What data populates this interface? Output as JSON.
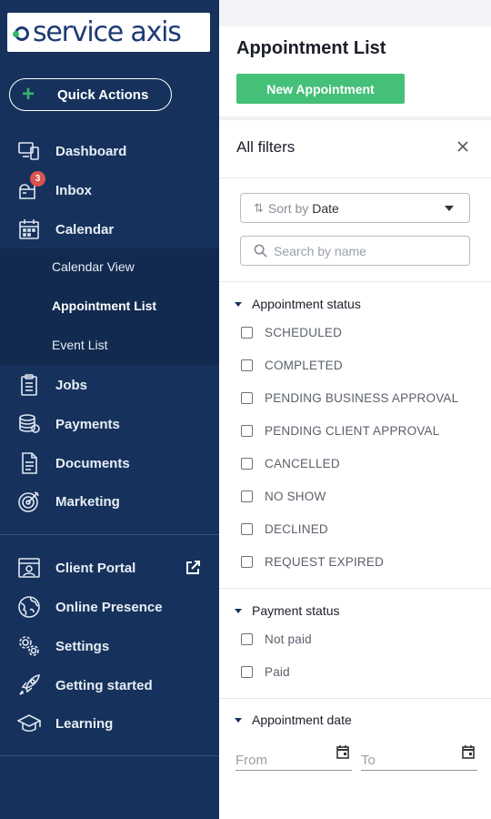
{
  "sidebar": {
    "logo_text": "service axis",
    "quick_actions_label": "Quick Actions",
    "items": [
      {
        "label": "Dashboard",
        "icon": "dashboard-icon"
      },
      {
        "label": "Inbox",
        "icon": "inbox-icon",
        "badge": "3"
      },
      {
        "label": "Calendar",
        "icon": "calendar-icon"
      },
      {
        "label": "Jobs",
        "icon": "clipboard-icon"
      },
      {
        "label": "Payments",
        "icon": "coins-icon"
      },
      {
        "label": "Documents",
        "icon": "document-icon"
      },
      {
        "label": "Marketing",
        "icon": "target-icon"
      }
    ],
    "calendar_submenu": [
      {
        "label": "Calendar View",
        "active": false
      },
      {
        "label": "Appointment List",
        "active": true
      },
      {
        "label": "Event List",
        "active": false
      }
    ],
    "secondary_items": [
      {
        "label": "Client Portal",
        "icon": "portal-icon"
      },
      {
        "label": "Online Presence",
        "icon": "globe-icon"
      },
      {
        "label": "Settings",
        "icon": "gears-icon"
      },
      {
        "label": "Getting started",
        "icon": "rocket-icon"
      },
      {
        "label": "Learning",
        "icon": "graduation-cap-icon"
      }
    ],
    "colors": {
      "background": "#16325c",
      "accent": "#35b26b"
    }
  },
  "main": {
    "title": "Appointment List",
    "new_button_label": "New Appointment",
    "filters": {
      "heading": "All filters",
      "sort_prefix": "Sort by",
      "sort_value": "Date",
      "search_placeholder": "Search by name",
      "appointment_status": {
        "label": "Appointment status",
        "options": [
          "SCHEDULED",
          "COMPLETED",
          "PENDING BUSINESS APPROVAL",
          "PENDING CLIENT APPROVAL",
          "CANCELLED",
          "NO SHOW",
          "DECLINED",
          "REQUEST EXPIRED"
        ]
      },
      "payment_status": {
        "label": "Payment status",
        "options": [
          "Not paid",
          "Paid"
        ]
      },
      "appointment_date": {
        "label": "Appointment date",
        "from_label": "From",
        "to_label": "To"
      }
    },
    "colors": {
      "primary_button": "#45c079"
    }
  }
}
